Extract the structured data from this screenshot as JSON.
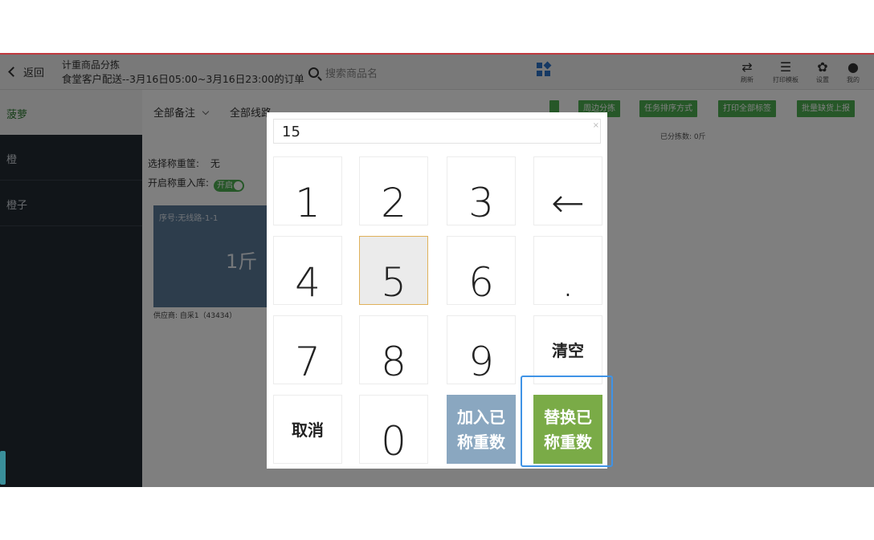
{
  "header": {
    "back_label": "返回",
    "title": "计重商品分拣",
    "subtitle": "食堂客户配送--3月16日05:00~3月16日23:00的订单",
    "search_placeholder": "搜索商品名",
    "tools": [
      {
        "label": "刷新",
        "icon": "refresh-icon"
      },
      {
        "label": "打印模板",
        "icon": "server-icon"
      },
      {
        "label": "设置",
        "icon": "gear-icon"
      },
      {
        "label": "我的",
        "icon": "user-icon"
      }
    ]
  },
  "category": "菠萝",
  "filters": {
    "note": "全部备注",
    "route": "全部线路"
  },
  "actions": [
    "周边分拣",
    "任务排序方式",
    "打印全部标签",
    "批量缺货上报"
  ],
  "sorted_count": "已分拣数: 0斤",
  "sidebar": {
    "items": [
      "橙",
      "橙子"
    ]
  },
  "main": {
    "basket_label": "选择称重筐:",
    "basket_value": "无",
    "weigh_label": "开启称重入库:",
    "toggle_label": "开启",
    "card": {
      "seq": "序号:无线路-1-1",
      "weight": "1斤"
    },
    "supplier": "供应商: 自采1（43434）"
  },
  "keypad": {
    "display_value": "15",
    "keys": [
      "1",
      "2",
      "3",
      "←",
      "4",
      "5",
      "6",
      ".",
      "7",
      "8",
      "9",
      "清空",
      "取消",
      "0"
    ],
    "add_line1": "加入已",
    "add_line2": "称重数",
    "replace_line1": "替换已",
    "replace_line2": "称重数"
  }
}
